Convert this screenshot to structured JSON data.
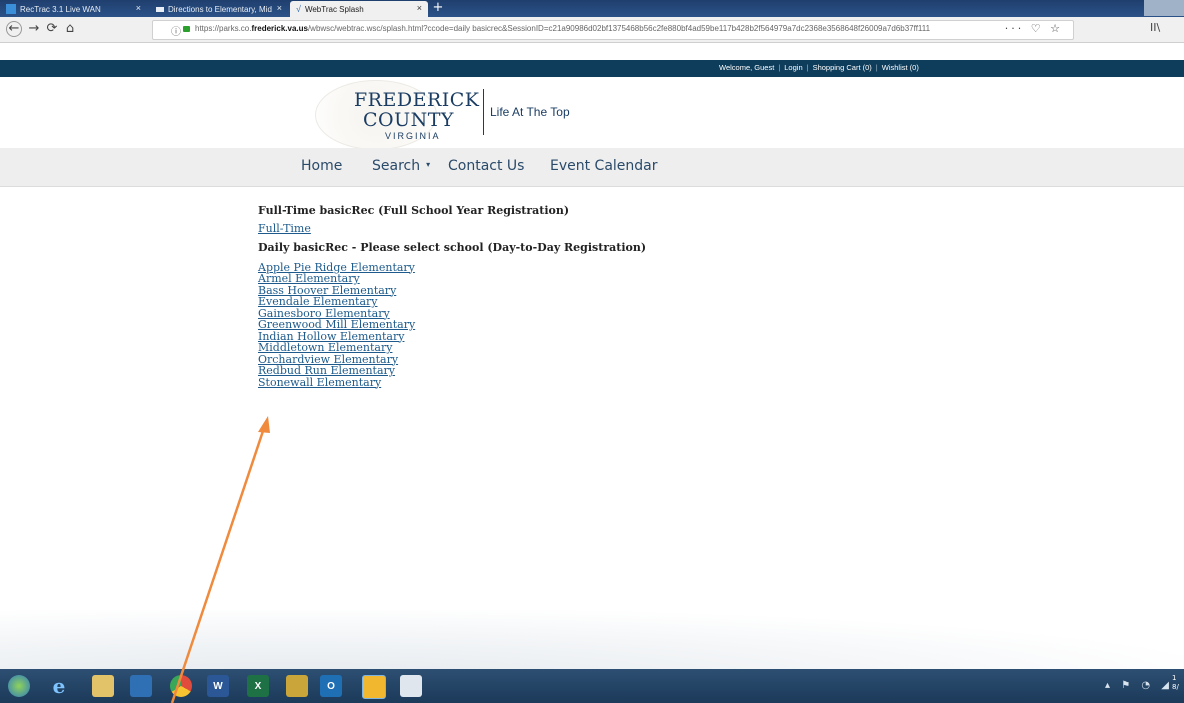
{
  "browser": {
    "tabs": [
      {
        "label": "RecTrac 3.1 Live WAN"
      },
      {
        "label": "Directions to Elementary, Mid"
      },
      {
        "label": "WebTrac Splash"
      }
    ],
    "close_glyph": "×",
    "new_tab_glyph": "+",
    "nav": {
      "back": "←",
      "forward": "→",
      "reload": "⟳",
      "home": "⌂"
    },
    "url_prefix": "https://parks.co.",
    "url_domain": "frederick.va.us",
    "url_suffix": "/wbwsc/webtrac.wsc/splash.html?ccode=daily basicrec&SessionID=c21a90986d02bf1375468b56c2fe880bf4ad59be117b428b2f564979a7dc2368e3568648f26009a7d6b37ff111",
    "page_actions": "··· ♡ ☆",
    "library": "II\\"
  },
  "site": {
    "account_links": [
      "Welcome, Guest",
      "Login",
      "Shopping Cart (0)",
      "Wishlist (0)"
    ],
    "logo": {
      "line1": "FREDERICK",
      "line2": "COUNTY",
      "line3": "VIRGINIA"
    },
    "tagline": "Life At The Top",
    "menu": {
      "home": "Home",
      "search": "Search",
      "search_caret": "▾",
      "contact": "Contact Us",
      "calendar": "Event Calendar"
    }
  },
  "content": {
    "fulltime_heading": "Full-Time basicRec (Full School Year Registration)",
    "fulltime_link": "Full-Time",
    "daily_heading": "Daily basicRec - Please select school (Day-to-Day Registration)",
    "schools": [
      "Apple Pie Ridge Elementary",
      "Armel Elementary",
      "Bass Hoover Elementary",
      "Evendale Elementary",
      "Gainesboro Elementary",
      "Greenwood Mill Elementary",
      "Indian Hollow Elementary",
      "Middletown Elementary",
      "Orchardview Elementary",
      "Redbud Run Elementary",
      "Stonewall Elementary"
    ]
  },
  "taskbar": {
    "apps": [
      "start",
      "ie",
      "explorer",
      "media",
      "chrome",
      "word",
      "excel",
      "app",
      "outlook",
      "files",
      "app2"
    ],
    "labels": {
      "ie": "e",
      "word": "W",
      "excel": "X",
      "outlook": "O"
    },
    "tray": "▴ ⚑ ◔ ◢",
    "clock_line1": "1",
    "clock_line2": "8/"
  },
  "colors": {
    "site_bar": "#0e3d5c",
    "brand_blue": "#1b3d63",
    "link": "#1e5b8c",
    "annotation_arrow": "#f08a3c"
  }
}
